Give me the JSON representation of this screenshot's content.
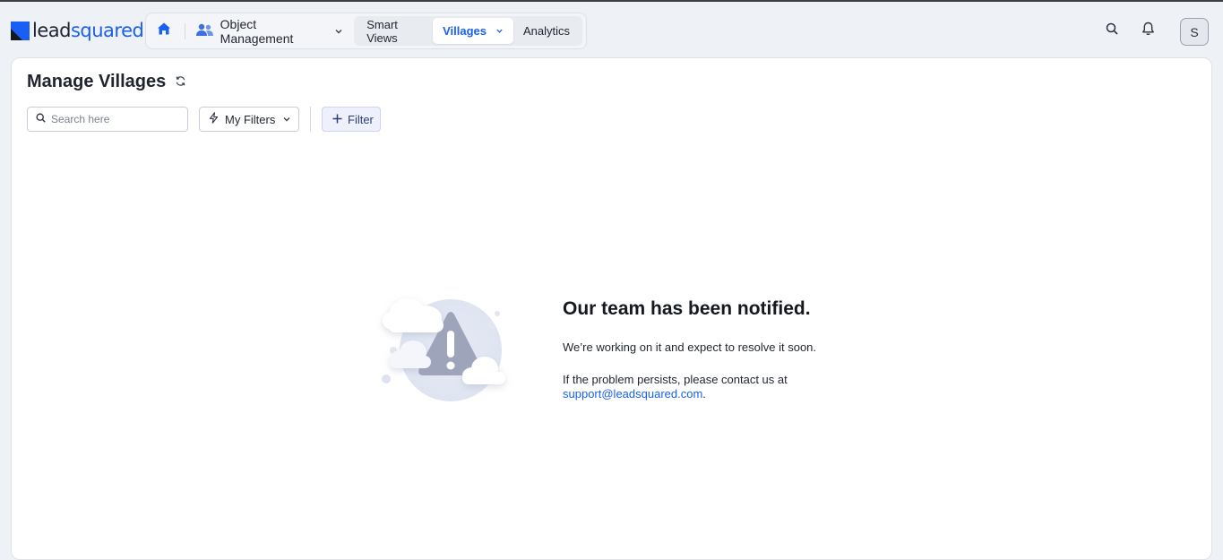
{
  "brand": {
    "lead": "lead",
    "squared": "squared",
    "accent_color": "#1a5ff5"
  },
  "nav": {
    "home_icon": "home-icon",
    "object_management": "Object Management",
    "tabs": [
      {
        "label": "Smart Views",
        "active": false
      },
      {
        "label": "Villages",
        "active": true
      },
      {
        "label": "Analytics",
        "active": false
      }
    ]
  },
  "header": {
    "search_icon": "search-icon",
    "notification_icon": "bell-icon",
    "avatar_initial": "S"
  },
  "page": {
    "title": "Manage Villages",
    "refresh_icon": "refresh-icon"
  },
  "toolbar": {
    "search_placeholder": "Search here",
    "my_filters_label": "My Filters",
    "filter_label": "Filter"
  },
  "error": {
    "illustration_icon": "warning-triangle-icon",
    "title": "Our team has been notified.",
    "line1": "We’re working on it and expect to resolve it soon.",
    "line2": "If the problem persists, please contact us at",
    "email": "support@leadsquared.com",
    "email_suffix": "."
  }
}
